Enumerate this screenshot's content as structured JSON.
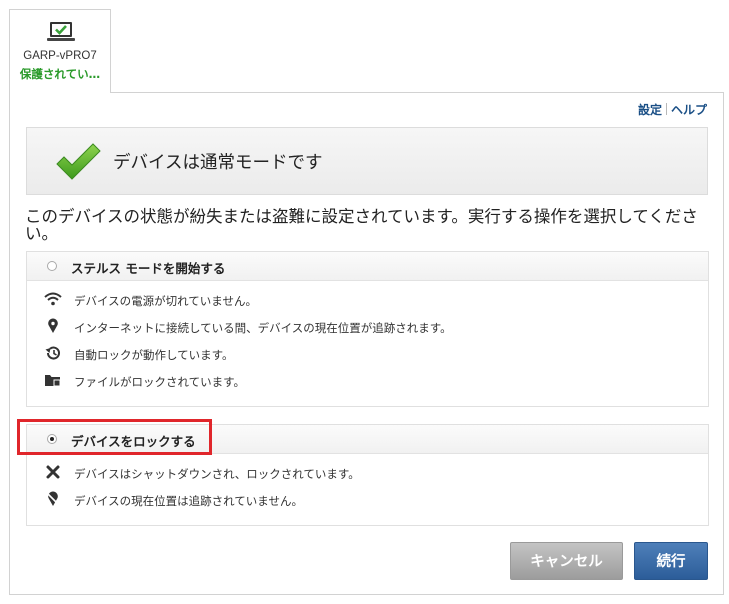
{
  "device_tab": {
    "name": "GARP-vPRO7",
    "status": "保護されてい…",
    "icon": "laptop-check-icon"
  },
  "top_links": {
    "settings": "設定",
    "help": "ヘルプ"
  },
  "mode_banner": {
    "icon": "green-check-icon",
    "title": "デバイスは通常モードです"
  },
  "description": "このデバイスの状態が紛失または盗難に設定されています。実行する操作を選択してください。",
  "options": {
    "stealth": {
      "label": "ステルス モードを開始する",
      "selected": false,
      "items": [
        {
          "icon": "wifi-icon",
          "text": "デバイスの電源が切れていません。"
        },
        {
          "icon": "location-pin-icon",
          "text": "インターネットに接続している間、デバイスの現在位置が追跡されます。"
        },
        {
          "icon": "history-clock-icon",
          "text": "自動ロックが動作しています。"
        },
        {
          "icon": "locked-folder-icon",
          "text": "ファイルがロックされています。"
        }
      ]
    },
    "lock": {
      "label": "デバイスをロックする",
      "selected": true,
      "items": [
        {
          "icon": "x-mark-icon",
          "text": "デバイスはシャットダウンされ、ロックされています。"
        },
        {
          "icon": "location-off-icon",
          "text": "デバイスの現在位置は追跡されていません。"
        }
      ]
    }
  },
  "buttons": {
    "cancel": "キャンセル",
    "continue": "続行"
  },
  "colors": {
    "status_green": "#2a9a2a",
    "link_blue": "#1a4f86",
    "continue_blue": "#2c5d99",
    "cancel_gray": "#a9a9a9",
    "highlight_red": "#e0262b"
  }
}
